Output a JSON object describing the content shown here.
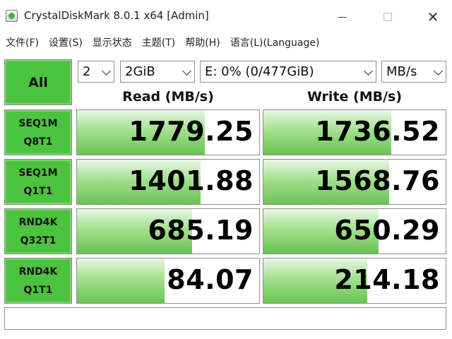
{
  "window": {
    "title": "CrystalDiskMark 8.0.1 x64 [Admin]"
  },
  "menu": [
    "文件(F)",
    "设置(S)",
    "显示状态",
    "主题(T)",
    "帮助(H)",
    "语言(L)(Language)"
  ],
  "controls": {
    "all_label": "All",
    "test_count": "2",
    "test_size": "2GiB",
    "drive": "E: 0% (0/477GiB)",
    "unit": "MB/s"
  },
  "columns": {
    "read": "Read (MB/s)",
    "write": "Write (MB/s)"
  },
  "results": [
    {
      "label1": "SEQ1M",
      "label2": "Q8T1",
      "read": "1779.25",
      "write": "1736.52",
      "read_fill_pct": 70,
      "write_fill_pct": 70
    },
    {
      "label1": "SEQ1M",
      "label2": "Q1T1",
      "read": "1401.88",
      "write": "1568.76",
      "read_fill_pct": 68,
      "write_fill_pct": 69
    },
    {
      "label1": "RND4K",
      "label2": "Q32T1",
      "read": "685.19",
      "write": "650.29",
      "read_fill_pct": 63,
      "write_fill_pct": 63
    },
    {
      "label1": "RND4K",
      "label2": "Q1T1",
      "read": "84.07",
      "write": "214.18",
      "read_fill_pct": 48,
      "write_fill_pct": 57
    }
  ],
  "icons": {
    "app": "crystaldiskmark-app-icon",
    "minimize": "minimize-icon",
    "maximize": "maximize-icon",
    "close": "close-icon",
    "dropdown": "chevron-down-icon"
  }
}
